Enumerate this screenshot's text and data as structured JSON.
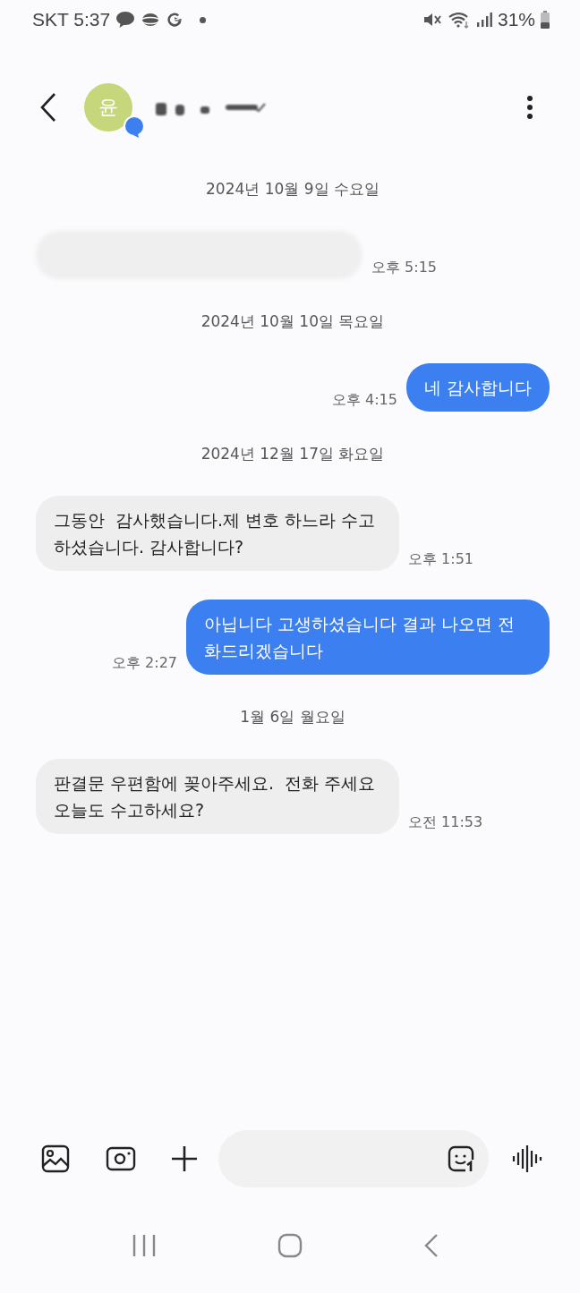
{
  "status_bar": {
    "carrier": "SKT",
    "time": "5:37",
    "battery": "31%"
  },
  "header": {
    "avatar_initial": "윤"
  },
  "messages": [
    {
      "kind": "date",
      "text": "2024년 10월 9일 수요일"
    },
    {
      "kind": "redacted",
      "time": "오후 5:15"
    },
    {
      "kind": "date",
      "text": "2024년 10월 10일 목요일"
    },
    {
      "kind": "outgoing",
      "text": "네 감사합니다",
      "time": "오후 4:15"
    },
    {
      "kind": "date",
      "text": "2024년 12월 17일 화요일"
    },
    {
      "kind": "incoming",
      "text": "그동안  감사했습니다.제 변호 하느라 수고하셨습니다. 감사합니다?",
      "time": "오후 1:51"
    },
    {
      "kind": "outgoing",
      "text": "아닙니다 고생하셨습니다 결과 나오면 전화드리겠습니다",
      "time": "오후 2:27"
    },
    {
      "kind": "date",
      "text": "1월 6일 월요일"
    },
    {
      "kind": "incoming",
      "text": "판결문 우편함에 꽂아주세요.  전화 주세요 오늘도 수고하세요?",
      "time": "오전 11:53"
    }
  ]
}
